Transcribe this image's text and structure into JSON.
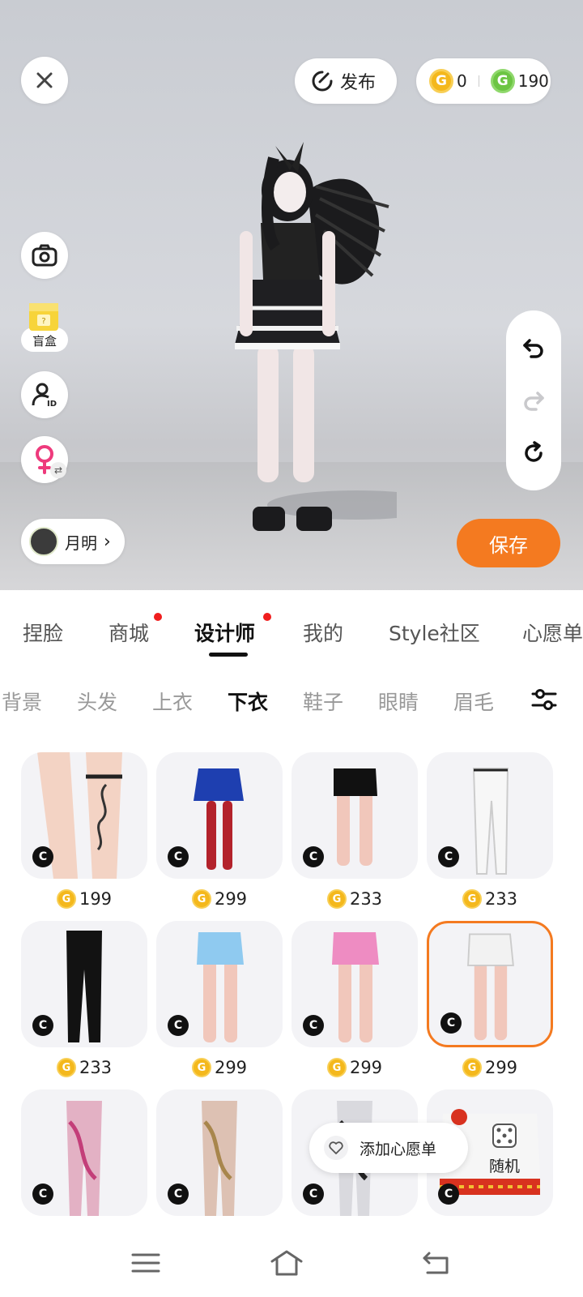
{
  "top_bar": {
    "publish_label": "发布",
    "gold_balance": "0",
    "green_balance": "190",
    "coin_symbol": "G"
  },
  "side_tools": {
    "blind_box_label": "盲盒",
    "id_label": "ID"
  },
  "profile": {
    "name": "月明"
  },
  "save_label": "保存",
  "main_tabs": [
    {
      "label": "捏脸",
      "dot": false
    },
    {
      "label": "商城",
      "dot": true
    },
    {
      "label": "设计师",
      "dot": true,
      "active": true
    },
    {
      "label": "我的",
      "dot": false
    },
    {
      "label": "Style社区",
      "dot": false
    },
    {
      "label": "心愿单",
      "dot": false
    }
  ],
  "sub_tabs": [
    {
      "label": "背景"
    },
    {
      "label": "头发"
    },
    {
      "label": "上衣"
    },
    {
      "label": "下衣",
      "active": true
    },
    {
      "label": "鞋子"
    },
    {
      "label": "眼睛"
    },
    {
      "label": "眉毛"
    }
  ],
  "items": [
    {
      "price": "199",
      "kind": "tattoo-legs"
    },
    {
      "price": "299",
      "kind": "blue-skirt-red-stockings"
    },
    {
      "price": "233",
      "kind": "black-shorts"
    },
    {
      "price": "233",
      "kind": "white-pants"
    },
    {
      "price": "233",
      "kind": "black-pants"
    },
    {
      "price": "299",
      "kind": "blue-shorts"
    },
    {
      "price": "299",
      "kind": "pink-shorts"
    },
    {
      "price": "299",
      "kind": "white-shorts",
      "selected": true
    },
    {
      "price": "",
      "kind": "pink-patterned-leggings"
    },
    {
      "price": "",
      "kind": "gold-patterned-leggings"
    },
    {
      "price": "",
      "kind": "dark-patterned-leggings"
    },
    {
      "price": "",
      "kind": "red-white-shorts"
    }
  ],
  "item_badge": "C",
  "wishlist_label": "添加心愿单",
  "random_label": "随机",
  "colors": {
    "accent_orange": "#f47a20",
    "coin_gold": "#f4b81c",
    "coin_green": "#6cc543",
    "notification_red": "#f01e1e"
  }
}
